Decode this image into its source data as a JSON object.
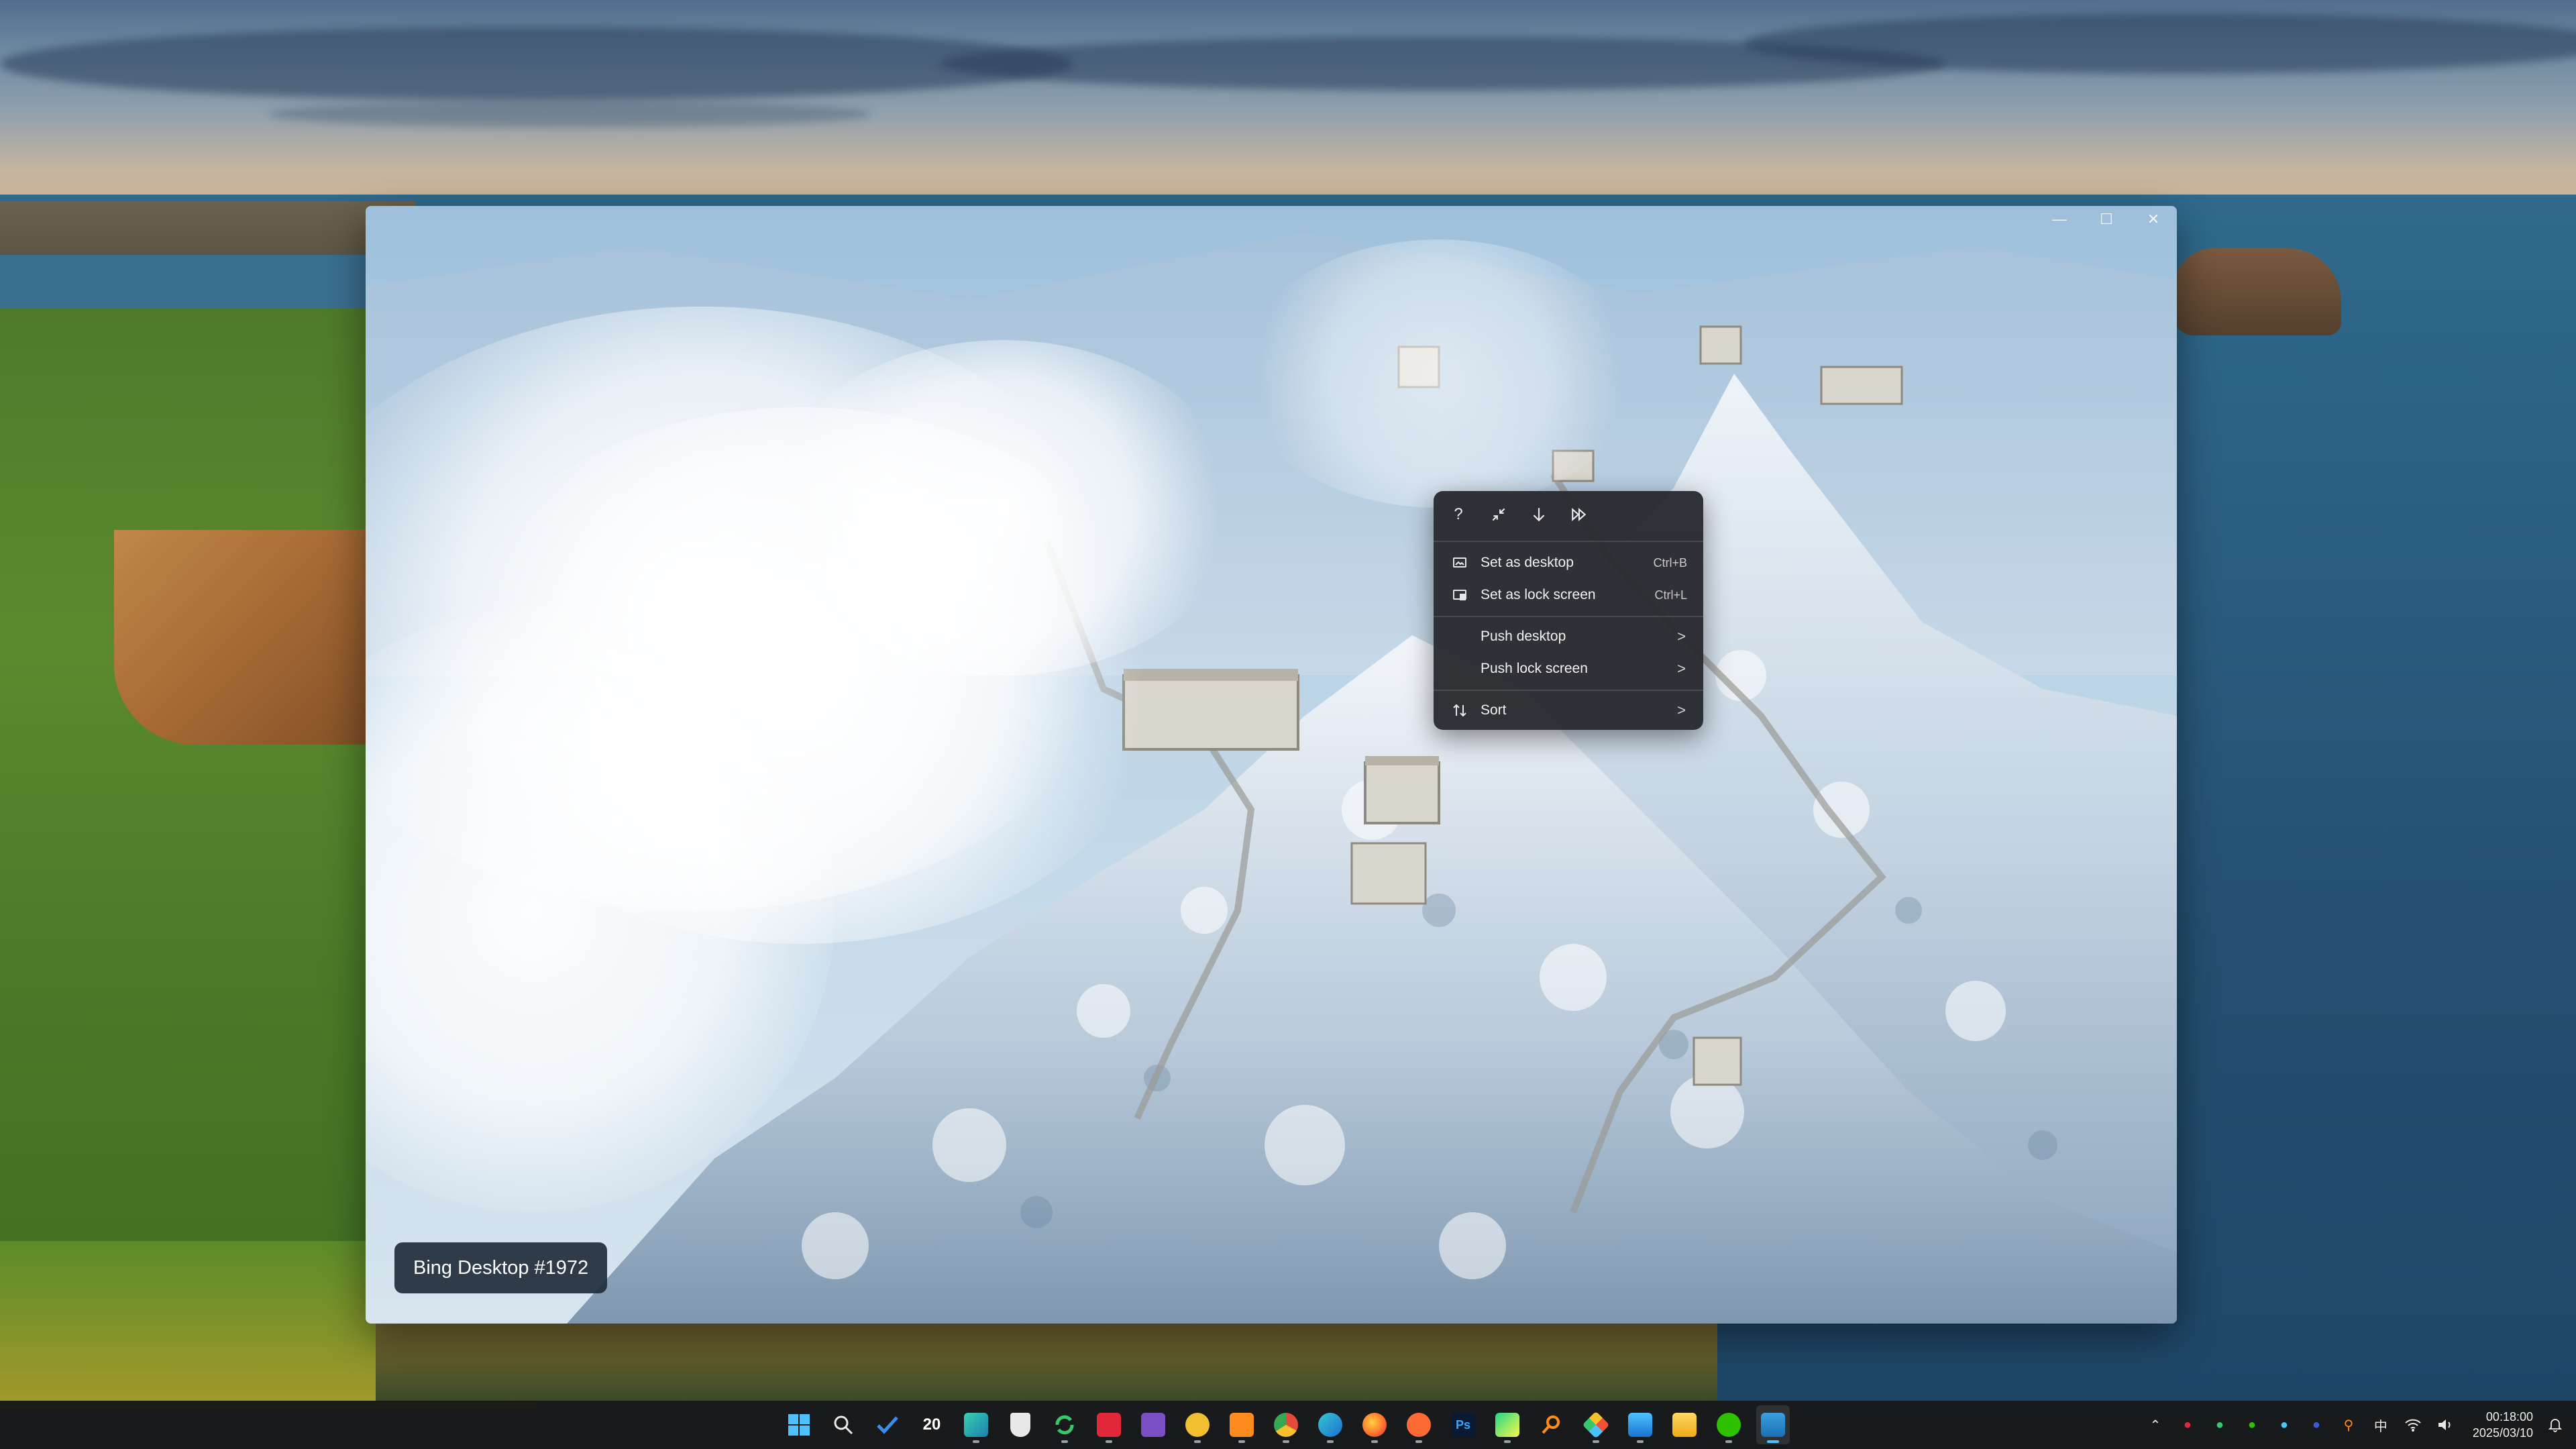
{
  "window": {
    "controls": {
      "minimize": "—",
      "maximize": "☐",
      "close": "✕"
    }
  },
  "context_menu": {
    "toolbar": [
      {
        "name": "help-icon",
        "label": "?"
      },
      {
        "name": "shrink-icon",
        "label": ""
      },
      {
        "name": "download-icon",
        "label": ""
      },
      {
        "name": "next-icon",
        "label": ""
      }
    ],
    "items": [
      {
        "label": "Set as desktop",
        "shortcut": "Ctrl+B",
        "icon": "desktop-icon"
      },
      {
        "label": "Set as lock screen",
        "shortcut": "Ctrl+L",
        "icon": "lock-screen-icon"
      },
      {
        "label": "Push desktop",
        "chevron": ">"
      },
      {
        "label": "Push lock screen",
        "chevron": ">"
      },
      {
        "label": "Sort",
        "chevron": ">",
        "icon": "sort-icon"
      }
    ]
  },
  "caption": {
    "text": "Bing Desktop #1972"
  },
  "taskbar": {
    "apps": [
      {
        "name": "start-icon",
        "label": ""
      },
      {
        "name": "search-icon",
        "label": ""
      },
      {
        "name": "todo-icon",
        "label": ""
      },
      {
        "name": "calendar-app-icon",
        "label": "20"
      },
      {
        "name": "photos-icon",
        "label": ""
      },
      {
        "name": "reader-icon",
        "label": ""
      },
      {
        "name": "sync-icon",
        "label": ""
      },
      {
        "name": "red-app-icon",
        "label": ""
      },
      {
        "name": "visual-studio-icon",
        "label": ""
      },
      {
        "name": "paw-app-icon",
        "label": ""
      },
      {
        "name": "sublime-icon",
        "label": ""
      },
      {
        "name": "chrome-icon",
        "label": ""
      },
      {
        "name": "edge-icon",
        "label": ""
      },
      {
        "name": "firefox-icon",
        "label": ""
      },
      {
        "name": "orange-app-icon",
        "label": ""
      },
      {
        "name": "photoshop-icon",
        "label": "Ps"
      },
      {
        "name": "pycharm-icon",
        "label": ""
      },
      {
        "name": "everything-search-icon",
        "label": ""
      },
      {
        "name": "git-icon",
        "label": ""
      },
      {
        "name": "store-icon",
        "label": ""
      },
      {
        "name": "file-explorer-icon",
        "label": ""
      },
      {
        "name": "wechat-icon",
        "label": ""
      },
      {
        "name": "bing-wallpaper-icon",
        "label": ""
      }
    ],
    "tray": {
      "ime": "中",
      "time": "00:18:00",
      "date": "2025/03/10"
    }
  },
  "colors": {
    "accent": "#4cc2ff",
    "menu_bg": "#2a2c30",
    "taskbar_bg": "#181818",
    "caption_bg": "#212c3a"
  }
}
